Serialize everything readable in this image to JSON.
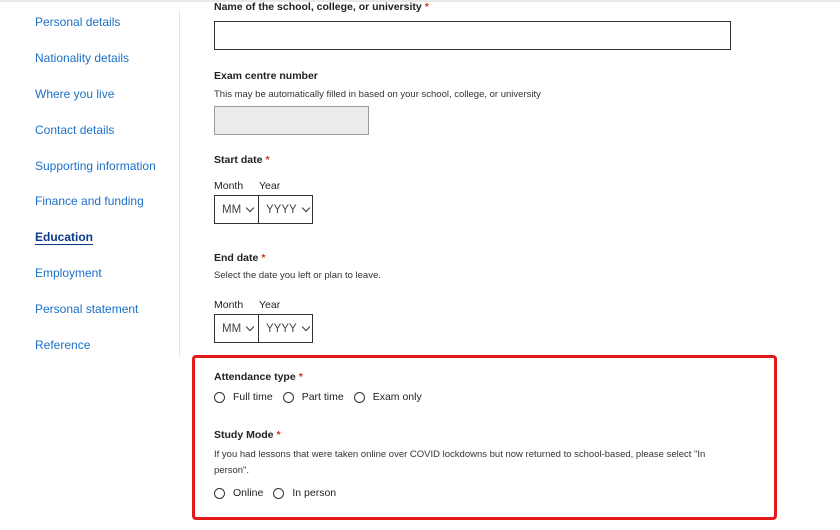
{
  "sidebar": {
    "items": [
      {
        "label": "Personal details",
        "active": false
      },
      {
        "label": "Nationality details",
        "active": false
      },
      {
        "label": "Where you live",
        "active": false
      },
      {
        "label": "Contact details",
        "active": false
      },
      {
        "label": "Supporting information",
        "active": false
      },
      {
        "label": "Finance and funding",
        "active": false
      },
      {
        "label": "Education",
        "active": true
      },
      {
        "label": "Employment",
        "active": false
      },
      {
        "label": "Personal statement",
        "active": false
      },
      {
        "label": "Reference",
        "active": false
      }
    ]
  },
  "form": {
    "school_name": {
      "label": "Name of the school, college, or university",
      "required_mark": "*",
      "value": ""
    },
    "exam_centre": {
      "label": "Exam centre number",
      "hint": "This may be automatically filled in based on your school, college, or university",
      "value": ""
    },
    "start_date": {
      "label": "Start date",
      "required_mark": "*",
      "month_label": "Month",
      "year_label": "Year",
      "month_value": "MM",
      "year_value": "YYYY"
    },
    "end_date": {
      "label": "End date",
      "required_mark": "*",
      "hint": "Select the date you left or plan to leave.",
      "month_label": "Month",
      "year_label": "Year",
      "month_value": "MM",
      "year_value": "YYYY"
    },
    "attendance_type": {
      "label": "Attendance type",
      "required_mark": "*",
      "options": [
        "Full time",
        "Part time",
        "Exam only"
      ]
    },
    "study_mode": {
      "label": "Study Mode",
      "required_mark": "*",
      "hint": "If you had lessons that were taken online over COVID lockdowns but now returned to school-based, please select \"In person\".",
      "options": [
        "Online",
        "In person"
      ]
    }
  },
  "colors": {
    "link": "#1c70c7",
    "active_link": "#0b3a8a",
    "required": "#d4351c",
    "highlight": "#e21a1a"
  },
  "icons": {
    "select_arrow": "chevron-down-icon"
  }
}
